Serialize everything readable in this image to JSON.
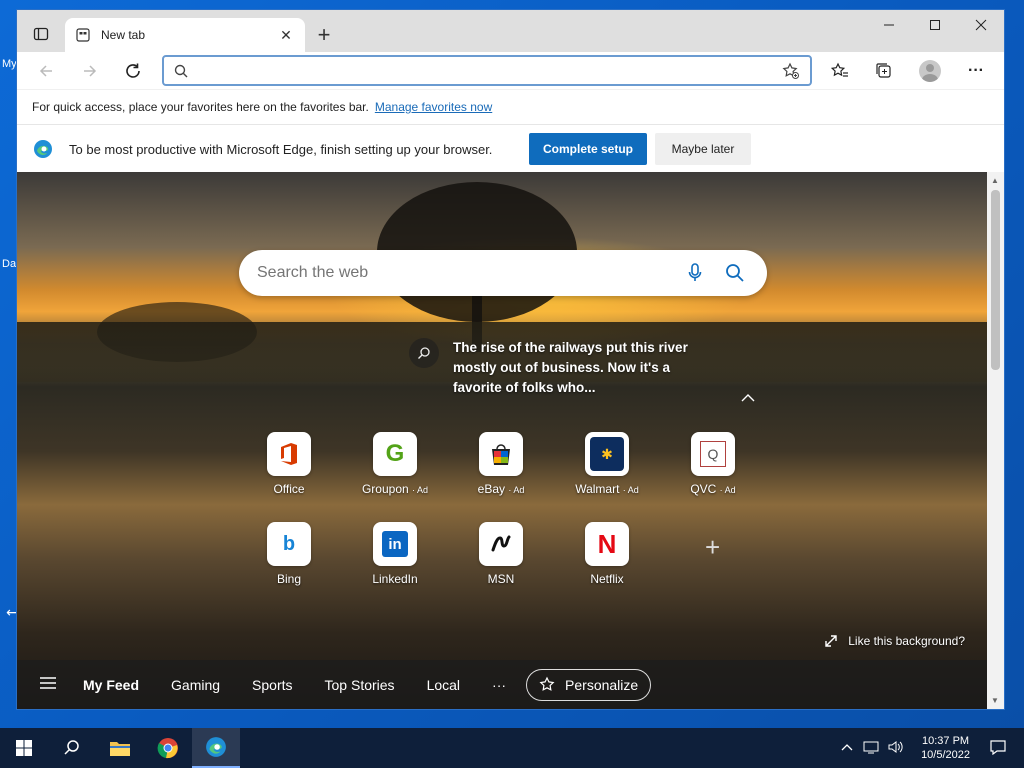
{
  "desktop": {
    "icon_labels": [
      "My",
      "Da"
    ]
  },
  "browser": {
    "tab": {
      "title": "New tab"
    },
    "address": {
      "value": "",
      "placeholder": ""
    },
    "favorites_bar": {
      "message": "For quick access, place your favorites here on the favorites bar.",
      "link": "Manage favorites now"
    },
    "setup_bar": {
      "message": "To be most productive with Microsoft Edge, finish setting up your browser.",
      "primary": "Complete setup",
      "secondary": "Maybe later"
    }
  },
  "ntp": {
    "search_placeholder": "Search the web",
    "story": "The rise of the railways put this river mostly out of business. Now it's a favorite of folks who...",
    "tiles": [
      {
        "label": "Office",
        "ad": "",
        "icon": "office-icon"
      },
      {
        "label": "Groupon",
        "ad": "· Ad",
        "icon": "groupon-icon"
      },
      {
        "label": "eBay",
        "ad": "· Ad",
        "icon": "ebay-icon"
      },
      {
        "label": "Walmart",
        "ad": "· Ad",
        "icon": "walmart-icon"
      },
      {
        "label": "QVC",
        "ad": "· Ad",
        "icon": "qvc-icon"
      },
      {
        "label": "Bing",
        "ad": "",
        "icon": "bing-icon"
      },
      {
        "label": "LinkedIn",
        "ad": "",
        "icon": "linkedin-icon"
      },
      {
        "label": "MSN",
        "ad": "",
        "icon": "msn-icon"
      },
      {
        "label": "Netflix",
        "ad": "",
        "icon": "netflix-icon"
      }
    ],
    "like_background": "Like this background?",
    "feed": {
      "items": [
        "My Feed",
        "Gaming",
        "Sports",
        "Top Stories",
        "Local"
      ],
      "more": "···",
      "personalize": "Personalize"
    }
  },
  "taskbar": {
    "time": "10:37 PM",
    "date": "10/5/2022"
  },
  "colors": {
    "accent": "#0f6cbd",
    "link": "#1a6bb8",
    "taskbar": "#0e1f3a"
  }
}
